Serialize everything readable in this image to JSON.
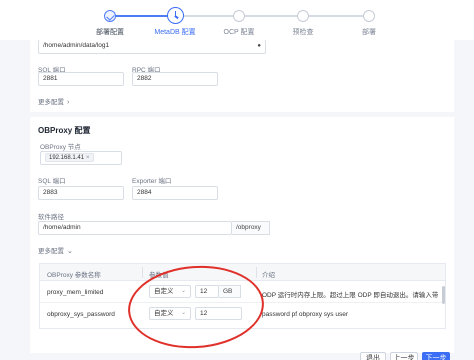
{
  "stepper": {
    "steps": [
      {
        "label": "部署配置",
        "state": "done"
      },
      {
        "label": "MetaDB 配置",
        "state": "active"
      },
      {
        "label": "OCP 配置",
        "state": "pending"
      },
      {
        "label": "预检查",
        "state": "pending"
      },
      {
        "label": "部署",
        "state": "pending"
      }
    ]
  },
  "metadb": {
    "log_path_value": "/home/admin/data/log1",
    "sql_port_label": "SQL 端口",
    "sql_port_value": "2881",
    "rpc_port_label": "RPC 端口",
    "rpc_port_value": "2882",
    "more_label": "更多配置"
  },
  "obproxy": {
    "title": "OBProxy 配置",
    "nodes_label": "OBProxy 节点",
    "node_tag": "192.168.1.41",
    "sql_port_label": "SQL 端口",
    "sql_port_value": "2883",
    "exporter_port_label": "Exporter 端口",
    "exporter_port_value": "2884",
    "software_path_label": "软件路径",
    "software_path_value": "/home/admin",
    "software_path_suffix": "/obproxy",
    "more_label": "更多配置",
    "table": {
      "headers": [
        "OBProxy 参数名称",
        "参数值",
        "介绍"
      ],
      "rows": [
        {
          "name": "proxy_mem_limited",
          "mode": "自定义",
          "value": "12",
          "unit": "GB",
          "description": "ODP 运行时内存上限。超过上限 ODP 即自动退出。请输入带容..."
        },
        {
          "name": "obproxy_sys_password",
          "mode": "自定义",
          "value": "12",
          "unit": "",
          "description": "password pf obproxy sys user"
        }
      ]
    }
  },
  "footer": {
    "exit_label": "退出",
    "prev_label": "上一步",
    "next_label": "下一步"
  },
  "colors": {
    "accent": "#3b6ef5",
    "annotation": "#e0302a"
  }
}
